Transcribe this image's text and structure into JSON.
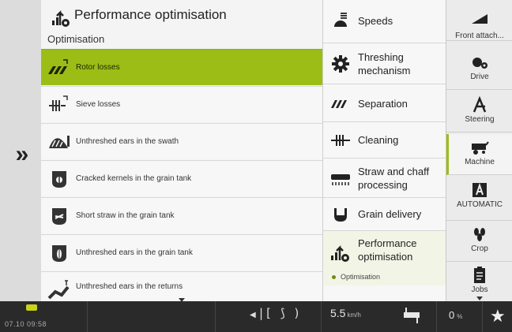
{
  "nav": {
    "expand_icon": "double-chevron-right-icon",
    "expand_glyph": "»"
  },
  "main": {
    "title": "Performance optimisation",
    "section_label": "Optimisation",
    "title_icon": "performance-optimisation-icon",
    "rows": [
      {
        "label": "Rotor losses",
        "icon": "rotor-losses-icon",
        "active": true
      },
      {
        "label": "Sieve losses",
        "icon": "sieve-losses-icon",
        "active": false
      },
      {
        "label": "Unthreshed ears in the swath",
        "icon": "ears-swath-icon",
        "active": false
      },
      {
        "label": "Cracked kernels in the grain tank",
        "icon": "grain-tank-cracked-icon",
        "active": false
      },
      {
        "label": "Short straw in the grain tank",
        "icon": "grain-tank-straw-icon",
        "active": false
      },
      {
        "label": "Unthreshed ears in the grain tank",
        "icon": "grain-tank-ears-icon",
        "active": false
      },
      {
        "label": "Unthreshed ears in the returns",
        "icon": "returns-icon",
        "active": false
      }
    ]
  },
  "menu": {
    "items": [
      {
        "label": "Speeds",
        "icon": "speeds-icon"
      },
      {
        "label": "Threshing mechanism",
        "icon": "threshing-gear-icon"
      },
      {
        "label": "Separation",
        "icon": "separation-icon"
      },
      {
        "label": "Cleaning",
        "icon": "cleaning-icon"
      },
      {
        "label": "Straw and chaff processing",
        "icon": "straw-chaff-icon"
      },
      {
        "label": "Grain delivery",
        "icon": "grain-delivery-icon"
      },
      {
        "label": "Performance optimisation",
        "icon": "performance-optimisation-icon",
        "sub": "Optimisation"
      }
    ]
  },
  "sidebar": {
    "items": [
      {
        "label": "Front attach...",
        "icon": "front-attachment-icon"
      },
      {
        "label": "Drive",
        "icon": "drive-icon"
      },
      {
        "label": "Steering",
        "icon": "steering-icon"
      },
      {
        "label": "Machine",
        "icon": "combine-machine-icon",
        "selected": true
      },
      {
        "label": "AUTOMATIC",
        "icon": "automatic-a-icon"
      },
      {
        "label": "Crop",
        "icon": "crop-icon"
      },
      {
        "label": "Jobs",
        "icon": "jobs-clipboard-icon"
      }
    ]
  },
  "status": {
    "clock": "07.10   09:58",
    "speed_value": "5.5",
    "speed_unit": "km/h",
    "percent_value": "0",
    "percent_unit": "%",
    "star_glyph": "★",
    "nav_arrow_glyph": "◀",
    "center_ctl_glyph": "|[ ⟆ )"
  },
  "colors": {
    "accent": "#9cbd16",
    "bar": "#2a2a2a"
  }
}
